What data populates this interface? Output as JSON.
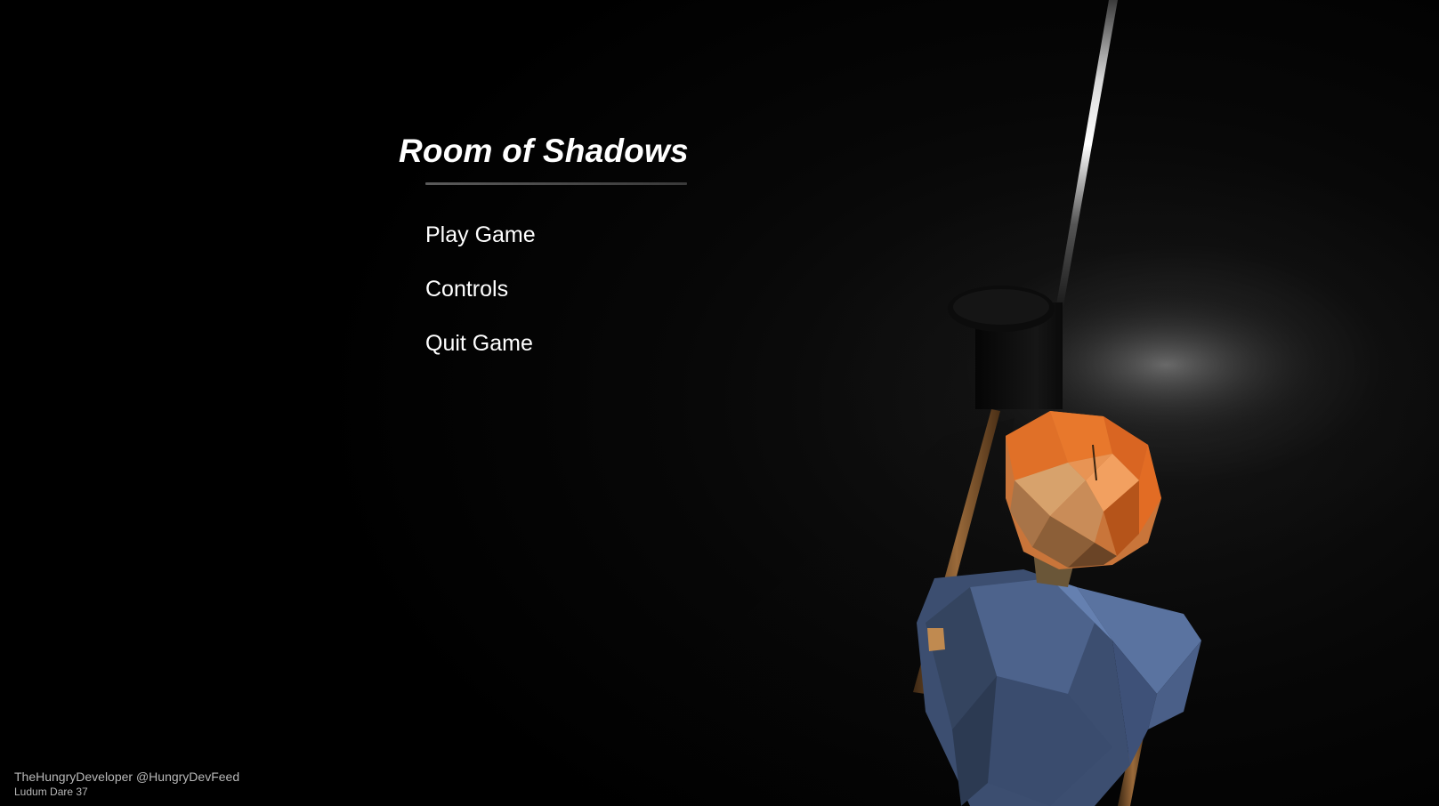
{
  "menu": {
    "title": "Room of Shadows",
    "items": [
      {
        "label": "Play Game"
      },
      {
        "label": "Controls"
      },
      {
        "label": "Quit Game"
      }
    ]
  },
  "credits": {
    "line1": "TheHungryDeveloper @HungryDevFeed",
    "line2": "Ludum Dare 37"
  },
  "colors": {
    "background": "#000000",
    "text": "#ffffff",
    "character_hair": "#e06a22",
    "character_shirt": "#4a5f86",
    "character_skin": "#c9915e",
    "staff": "#7a5230"
  }
}
